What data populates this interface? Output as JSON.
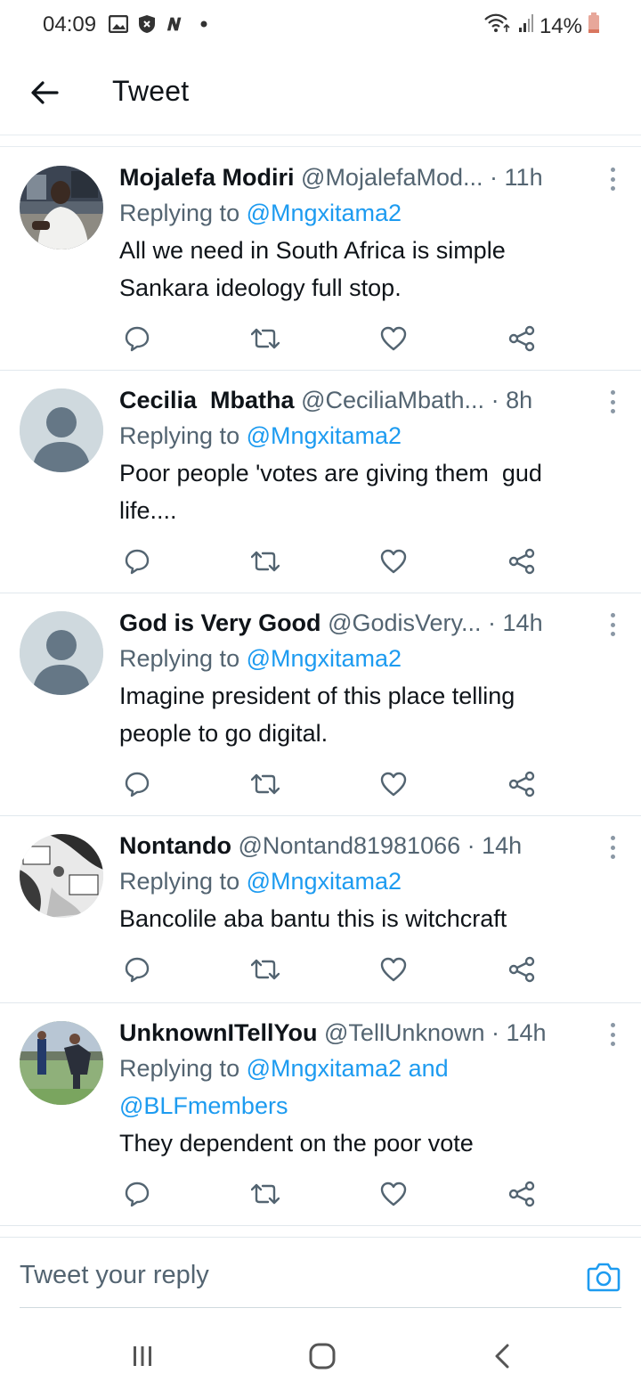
{
  "status_bar": {
    "time": "04:09",
    "battery": "14%",
    "icons": [
      "gallery-icon",
      "shield-icon",
      "n-icon",
      "dot-icon",
      "wifi-icon",
      "signal-icon",
      "battery-icon"
    ]
  },
  "header": {
    "title": "Tweet",
    "back_icon": "arrow-left-icon"
  },
  "tweets": [
    {
      "name": "Mojalefa Modiri",
      "handle": "@MojalefaMod...",
      "time": "· 11h",
      "replying_label": "Replying to ",
      "mentions": "@Mngxitama2",
      "text_lines": [
        "All we need in South Africa is simple",
        "Sankara ideology full stop."
      ],
      "avatar": "photo-man"
    },
    {
      "name": "Cecilia  Mbatha",
      "handle": "@CeciliaMbath...",
      "time": "· 8h",
      "replying_label": "Replying to ",
      "mentions": "@Mngxitama2",
      "text_lines": [
        "Poor people 'votes are giving them  gud",
        "life...."
      ],
      "avatar": "default"
    },
    {
      "name": "God is Very Good",
      "handle": "@GodisVery...",
      "time": "· 14h",
      "replying_label": "Replying to ",
      "mentions": "@Mngxitama2",
      "text_lines": [
        "Imagine president of this place telling",
        "people to go digital."
      ],
      "avatar": "default"
    },
    {
      "name": "Nontando",
      "handle": "@Nontand81981066",
      "time": "· 14h",
      "replying_label": "Replying to ",
      "mentions": "@Mngxitama2",
      "text_lines": [
        "Bancolile aba bantu this is witchcraft"
      ],
      "avatar": "comic"
    },
    {
      "name": "UnknownITellYou",
      "handle": "@TellUnknown",
      "time": "· 14h",
      "replying_label": "Replying to ",
      "mentions": "@Mngxitama2 and",
      "mentions_2": "@BLFmembers",
      "text_lines": [
        "They dependent on the poor vote"
      ],
      "avatar": "photo-outdoor"
    }
  ],
  "composer": {
    "placeholder": "Tweet your reply",
    "camera_icon": "camera-icon"
  },
  "navbar": {
    "icons": [
      "recent-apps-icon",
      "home-icon",
      "back-icon"
    ]
  },
  "colors": {
    "accent": "#1d9bf0",
    "text": "#0f1419",
    "muted": "#536471",
    "divider": "#e1e8ed"
  }
}
